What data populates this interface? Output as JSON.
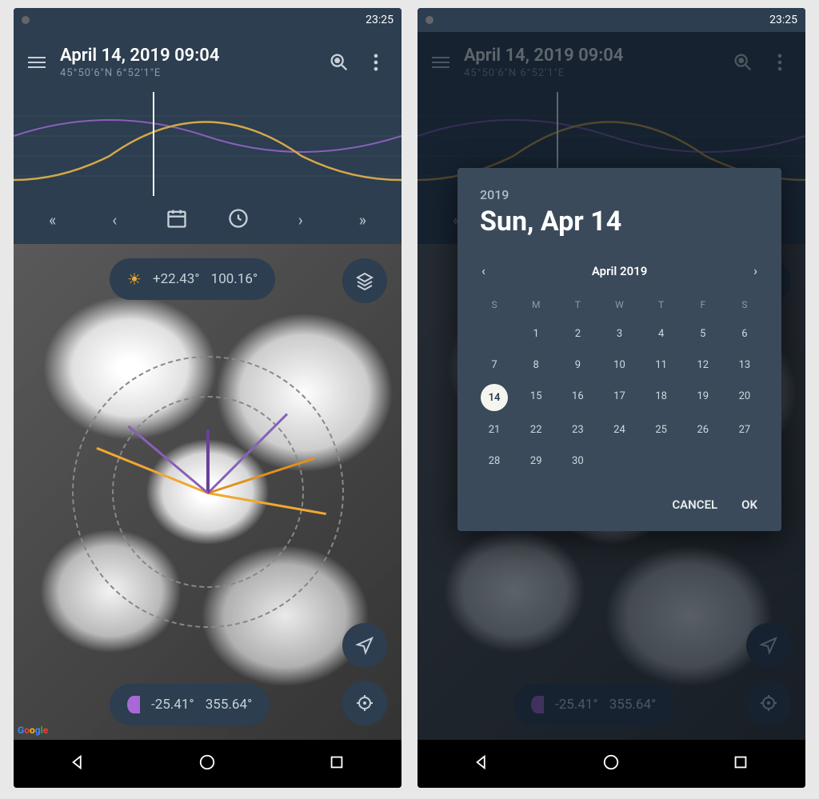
{
  "status": {
    "time": "23:25"
  },
  "header": {
    "datetime": "April 14, 2019 09:04",
    "coords": "45°50'6\"N 6°52'1\"E"
  },
  "sun": {
    "elevation": "+22.43°",
    "azimuth": "100.16°"
  },
  "moon": {
    "elevation": "-25.41°",
    "azimuth": "355.64°"
  },
  "picker": {
    "year": "2019",
    "date_label": "Sun, Apr 14",
    "month_label": "April 2019",
    "selected_day": 14,
    "cancel": "CANCEL",
    "ok": "OK",
    "dow": [
      "S",
      "M",
      "T",
      "W",
      "T",
      "F",
      "S"
    ],
    "first_day_offset": 1,
    "days_in_month": 30
  }
}
